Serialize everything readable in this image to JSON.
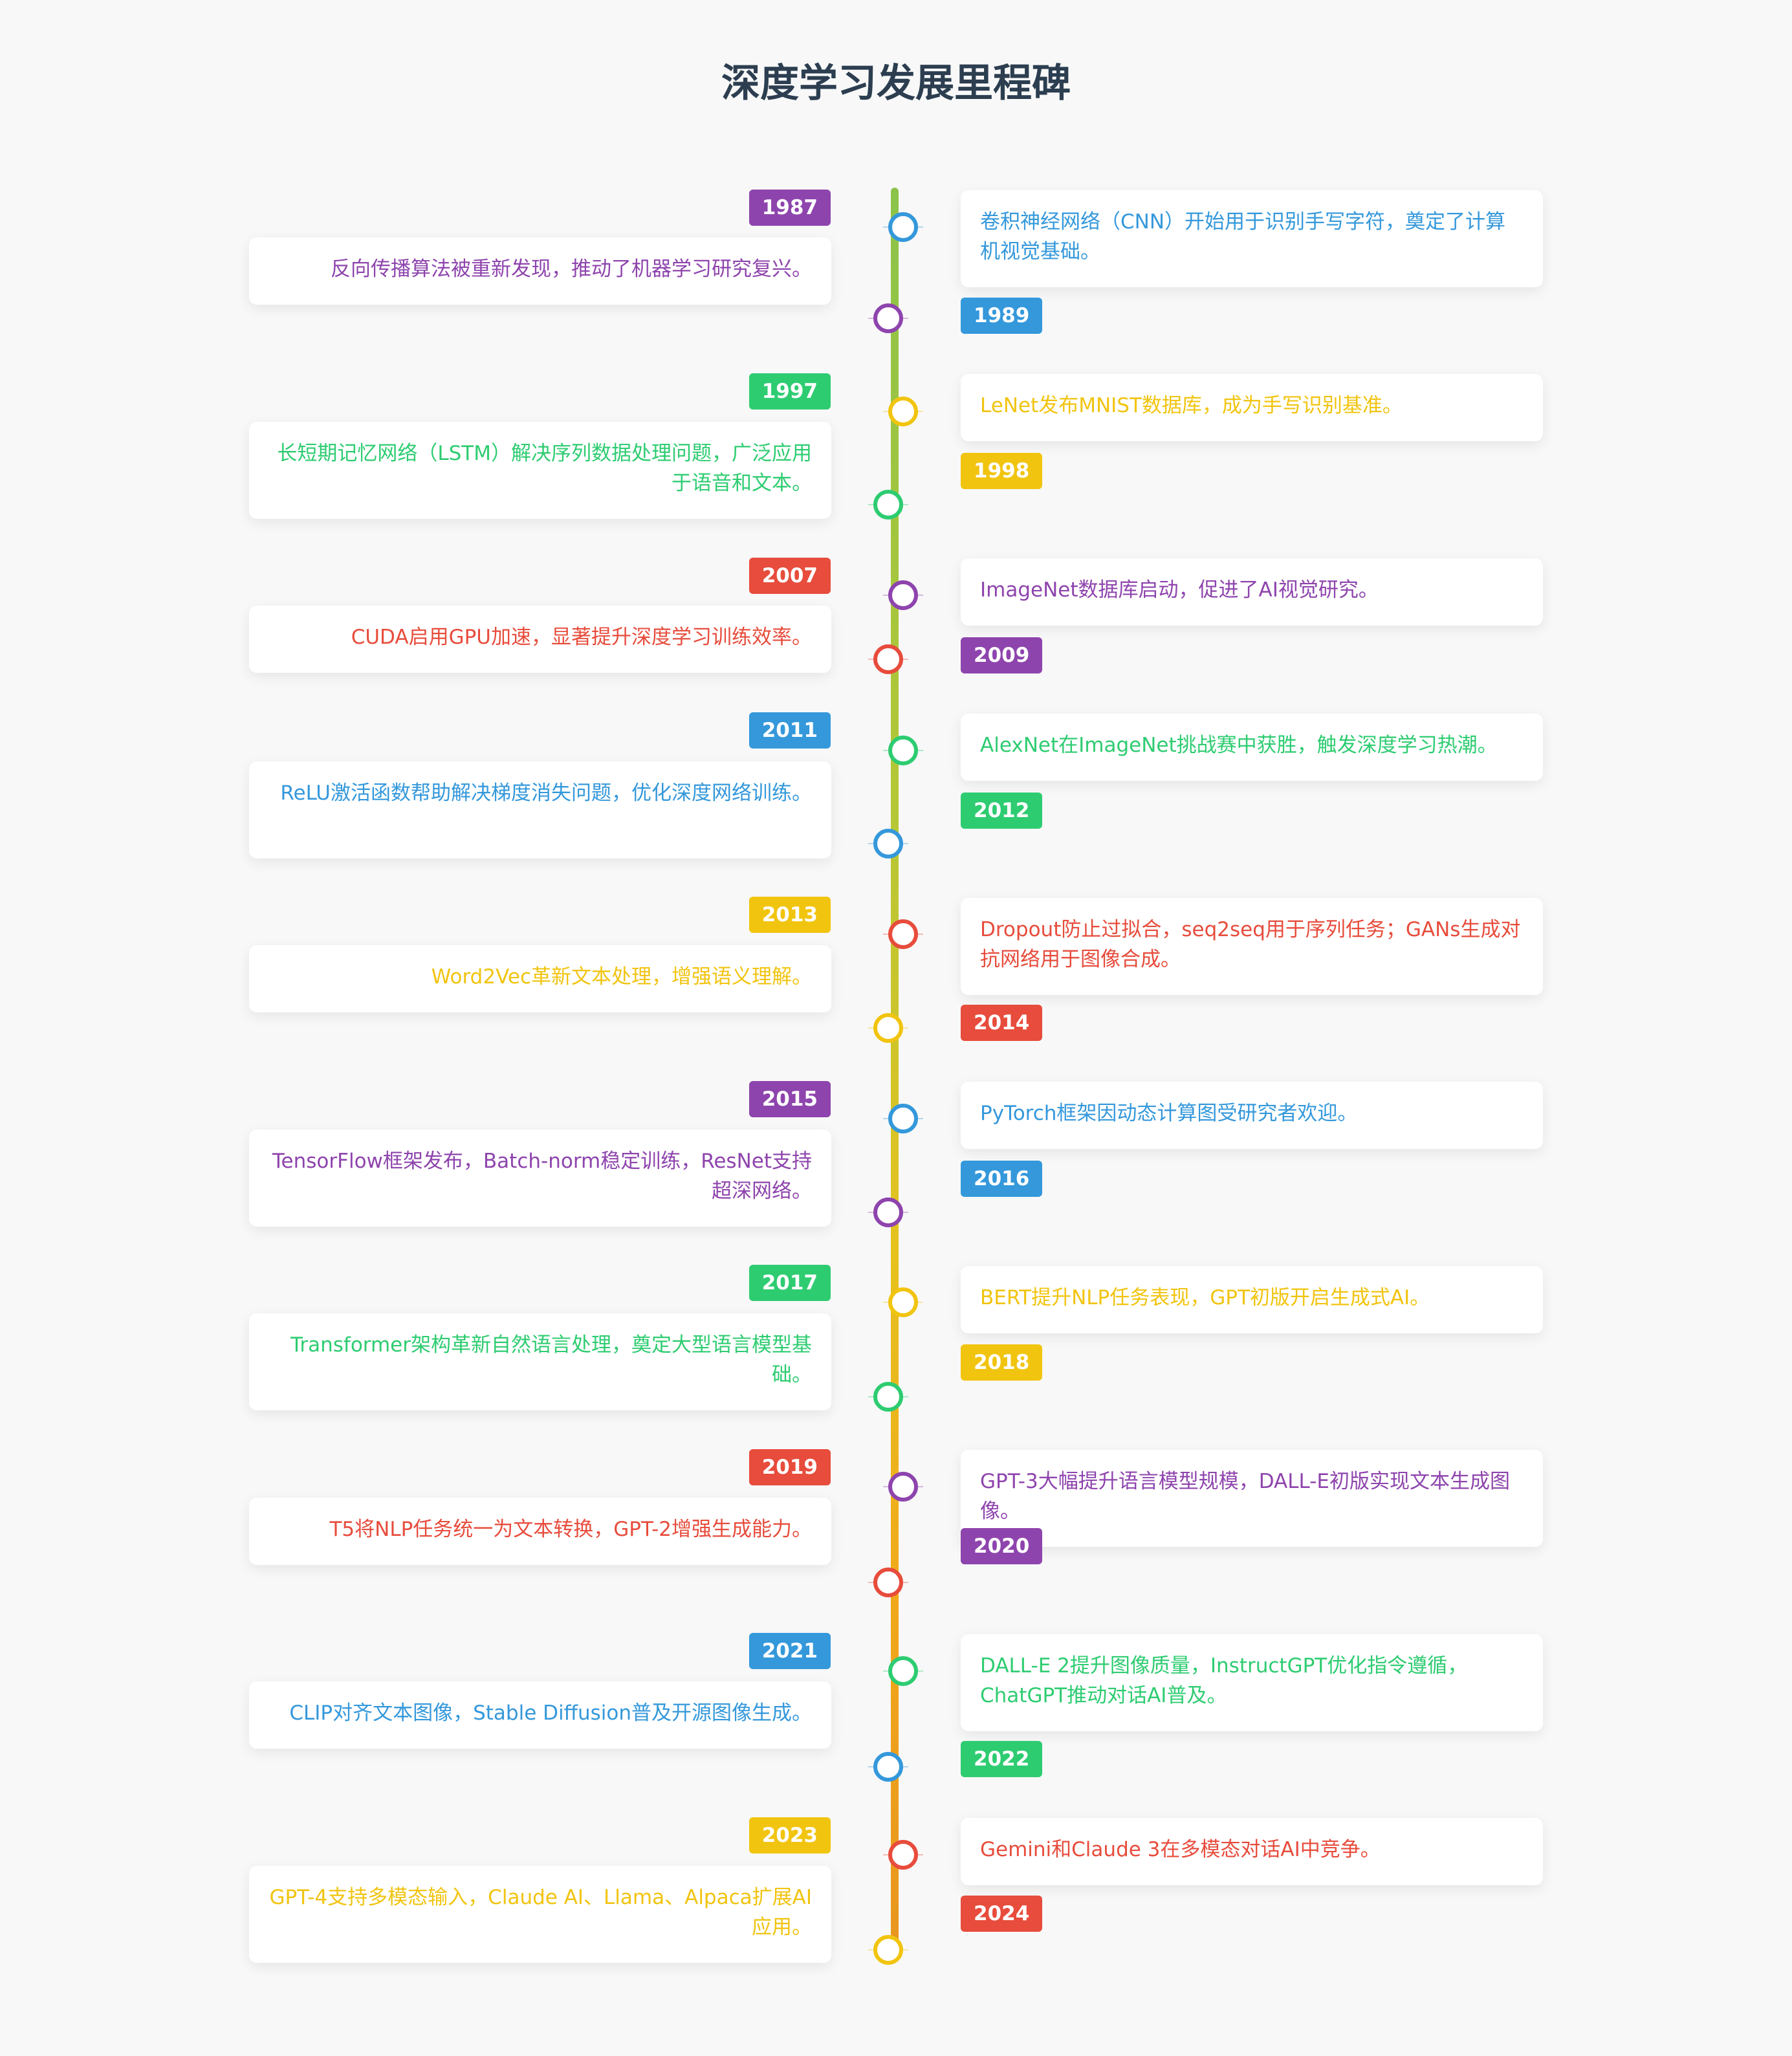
{
  "title": "深度学习发展里程碑",
  "palette": [
    "#8e44ad",
    "#3498db",
    "#2ecc71",
    "#f1c40f",
    "#e74c3c"
  ],
  "events": [
    {
      "year": "1987",
      "side": "left",
      "color": "#8e44ad",
      "text": "反向传播算法被重新发现，推动了机器学习研究复兴。"
    },
    {
      "year": "1989",
      "side": "right",
      "color": "#3498db",
      "text": "卷积神经网络（CNN）开始用于识别手写字符，奠定了计算机视觉基础。"
    },
    {
      "year": "1997",
      "side": "left",
      "color": "#2ecc71",
      "text": "长短期记忆网络（LSTM）解决序列数据处理问题，广泛应用于语音和文本。"
    },
    {
      "year": "1998",
      "side": "right",
      "color": "#f1c40f",
      "text": "LeNet发布MNIST数据库，成为手写识别基准。"
    },
    {
      "year": "2007",
      "side": "left",
      "color": "#e74c3c",
      "text": "CUDA启用GPU加速，显著提升深度学习训练效率。"
    },
    {
      "year": "2009",
      "side": "right",
      "color": "#8e44ad",
      "text": "ImageNet数据库启动，促进了AI视觉研究。"
    },
    {
      "year": "2011",
      "side": "left",
      "color": "#3498db",
      "text": "ReLU激活函数帮助解决梯度消失问题，优化深度网络训练。"
    },
    {
      "year": "2012",
      "side": "right",
      "color": "#2ecc71",
      "text": "AlexNet在ImageNet挑战赛中获胜，触发深度学习热潮。"
    },
    {
      "year": "2013",
      "side": "left",
      "color": "#f1c40f",
      "text": "Word2Vec革新文本处理，增强语义理解。"
    },
    {
      "year": "2014",
      "side": "right",
      "color": "#e74c3c",
      "text": "Dropout防止过拟合，seq2seq用于序列任务；GANs生成对抗网络用于图像合成。"
    },
    {
      "year": "2015",
      "side": "left",
      "color": "#8e44ad",
      "text": "TensorFlow框架发布，Batch-norm稳定训练，ResNet支持超深网络。"
    },
    {
      "year": "2016",
      "side": "right",
      "color": "#3498db",
      "text": "PyTorch框架因动态计算图受研究者欢迎。"
    },
    {
      "year": "2017",
      "side": "left",
      "color": "#2ecc71",
      "text": "Transformer架构革新自然语言处理，奠定大型语言模型基础。"
    },
    {
      "year": "2018",
      "side": "right",
      "color": "#f1c40f",
      "text": "BERT提升NLP任务表现，GPT初版开启生成式AI。"
    },
    {
      "year": "2019",
      "side": "left",
      "color": "#e74c3c",
      "text": "T5将NLP任务统一为文本转换，GPT-2增强生成能力。"
    },
    {
      "year": "2020",
      "side": "right",
      "color": "#8e44ad",
      "text": "GPT-3大幅提升语言模型规模，DALL-E初版实现文本生成图像。"
    },
    {
      "year": "2021",
      "side": "left",
      "color": "#3498db",
      "text": "CLIP对齐文本图像，Stable Diffusion普及开源图像生成。"
    },
    {
      "year": "2022",
      "side": "right",
      "color": "#2ecc71",
      "text": "DALL-E 2提升图像质量，InstructGPT优化指令遵循，ChatGPT推动对话AI普及。"
    },
    {
      "year": "2023",
      "side": "left",
      "color": "#f1c40f",
      "text": "GPT-4支持多模态输入，Claude AI、Llama、Alpaca扩展AI应用。"
    },
    {
      "year": "2024",
      "side": "right",
      "color": "#e74c3c",
      "text": "Gemini和Claude 3在多模态对话AI中竞争。"
    }
  ]
}
